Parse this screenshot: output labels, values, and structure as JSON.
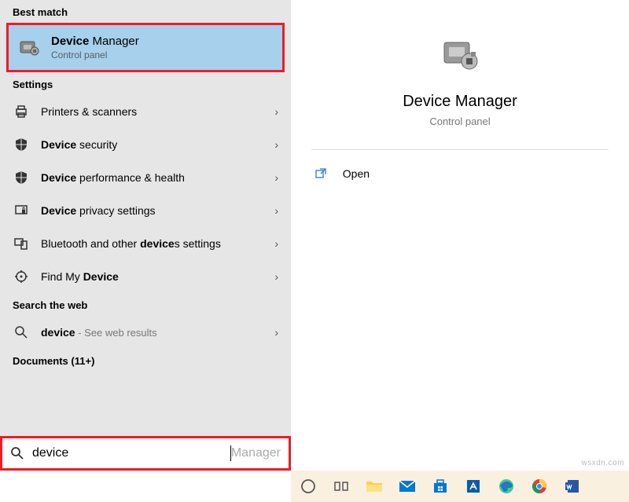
{
  "headers": {
    "best_match": "Best match",
    "settings": "Settings",
    "search_web": "Search the web",
    "documents": "Documents (11+)"
  },
  "best_match": {
    "title_bold": "Device",
    "title_rest": " Manager",
    "subtitle": "Control panel"
  },
  "settings_items": [
    {
      "icon": "printer-icon",
      "prefix": "",
      "bold": "",
      "text": "Printers & scanners"
    },
    {
      "icon": "shield-icon",
      "prefix": "",
      "bold": "Device",
      "text": " security"
    },
    {
      "icon": "shield-icon",
      "prefix": "",
      "bold": "Device",
      "text": " performance & health"
    },
    {
      "icon": "privacy-icon",
      "prefix": "",
      "bold": "Device",
      "text": " privacy settings"
    },
    {
      "icon": "bluetooth-icon",
      "prefix": "Bluetooth and other ",
      "bold": "device",
      "text": "s settings"
    },
    {
      "icon": "find-icon",
      "prefix": "Find My ",
      "bold": "Device",
      "text": ""
    }
  ],
  "web_item": {
    "bold": "device",
    "suffix": " - See web results"
  },
  "detail": {
    "title": "Device Manager",
    "subtitle": "Control panel",
    "open": "Open"
  },
  "search": {
    "typed": "device",
    "completion": " Manager"
  },
  "watermark": "wsxdn.com"
}
